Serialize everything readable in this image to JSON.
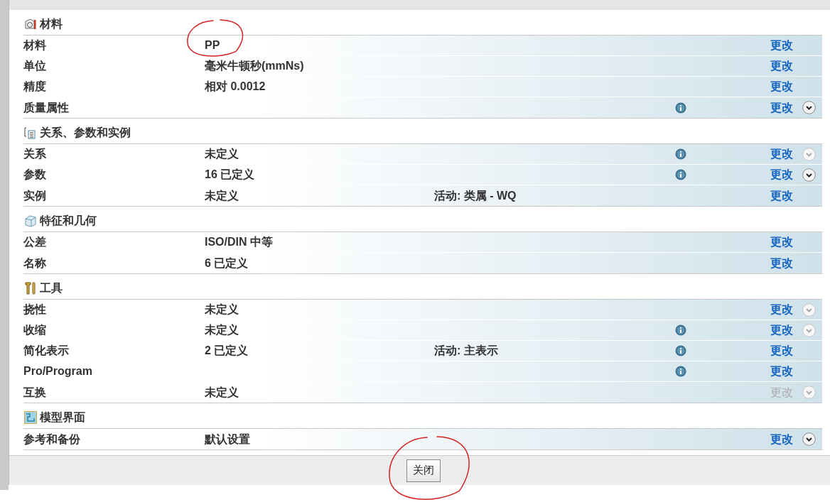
{
  "sections": [
    {
      "title": "材料",
      "kind": "material",
      "rows": [
        {
          "label": "材料",
          "value": "PP",
          "circled": true,
          "info": false,
          "link": "更改",
          "link_disabled": false,
          "expander": false
        },
        {
          "label": "单位",
          "value": "毫米牛顿秒(mmNs)",
          "info": false,
          "link": "更改",
          "link_disabled": false,
          "expander": false
        },
        {
          "label": "精度",
          "value": "相对 0.0012",
          "info": false,
          "link": "更改",
          "link_disabled": false,
          "expander": false
        },
        {
          "label": "质量属性",
          "info": true,
          "link": "更改",
          "link_disabled": false,
          "expander": true,
          "expander_disabled": false
        }
      ]
    },
    {
      "title": "关系、参数和实例",
      "kind": "relations",
      "rows": [
        {
          "label": "关系",
          "value": "未定义",
          "info": true,
          "link": "更改",
          "link_disabled": false,
          "expander": true,
          "expander_disabled": true
        },
        {
          "label": "参数",
          "value": "16 已定义",
          "info": true,
          "link": "更改",
          "link_disabled": false,
          "expander": true,
          "expander_disabled": false
        },
        {
          "label": "实例",
          "value": "未定义",
          "extra": "活动: 类属 - WQ",
          "info": false,
          "link": "更改",
          "link_disabled": false,
          "expander": false
        }
      ]
    },
    {
      "title": "特征和几何",
      "kind": "feature",
      "rows": [
        {
          "label": "公差",
          "value": "ISO/DIN 中等",
          "info": false,
          "link": "更改",
          "link_disabled": false,
          "expander": false
        },
        {
          "label": "名称",
          "value": "6 已定义",
          "info": false,
          "link": "更改",
          "link_disabled": false,
          "expander": false
        }
      ]
    },
    {
      "title": "工具",
      "kind": "tools",
      "rows": [
        {
          "label": "挠性",
          "value": "未定义",
          "info": false,
          "link": "更改",
          "link_disabled": false,
          "expander": true,
          "expander_disabled": true
        },
        {
          "label": "收缩",
          "value": "未定义",
          "info": true,
          "link": "更改",
          "link_disabled": false,
          "expander": true,
          "expander_disabled": true
        },
        {
          "label": "简化表示",
          "value": "2 已定义",
          "extra": "活动: 主表示",
          "info": true,
          "link": "更改",
          "link_disabled": false,
          "expander": false
        },
        {
          "label": "Pro/Program",
          "info": true,
          "link": "更改",
          "link_disabled": false,
          "expander": false
        },
        {
          "label": "互换",
          "value": "未定义",
          "info": false,
          "link": "更改",
          "link_disabled": true,
          "expander": true,
          "expander_disabled": true
        }
      ]
    },
    {
      "title": "模型界面",
      "kind": "interface",
      "rows": [
        {
          "label": "参考和备份",
          "value": "默认设置",
          "info": false,
          "link": "更改",
          "link_disabled": false,
          "expander": true,
          "expander_disabled": false
        }
      ]
    }
  ],
  "close_button": {
    "label": "关闭",
    "circled": true
  }
}
